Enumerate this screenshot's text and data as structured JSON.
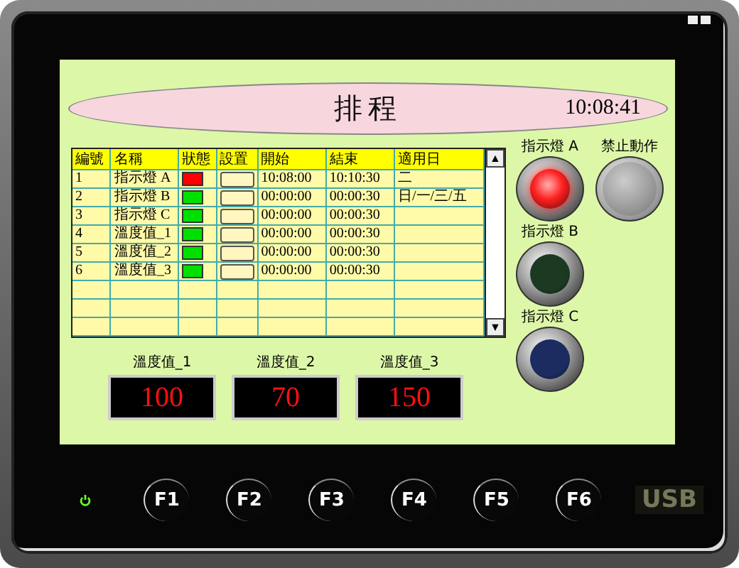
{
  "screen": {
    "title": "排程",
    "clock": "10:08:41",
    "table": {
      "columns": [
        "編號",
        "名稱",
        "狀態",
        "設置",
        "開始",
        "結束",
        "適用日"
      ],
      "rows": [
        {
          "number": "1",
          "name": "指示燈 A",
          "color": "#ff0000",
          "start": "10:08:00",
          "end": "10:10:30",
          "days": "二"
        },
        {
          "number": "2",
          "name": "指示燈 B",
          "color": "#00e000",
          "start": "00:00:00",
          "end": "00:00:30",
          "days": "日/一/三/五"
        },
        {
          "number": "3",
          "name": "指示燈 C",
          "color": "#00e000",
          "start": "00:00:00",
          "end": "00:00:30"
        },
        {
          "number": "4",
          "name": "溫度值_1",
          "color": "#00e000",
          "start": "00:00:00",
          "end": "00:00:30"
        },
        {
          "number": "5",
          "name": "溫度值_2",
          "color": "#00e000",
          "start": "00:00:00",
          "end": "00:00:30"
        },
        {
          "number": "6",
          "name": "溫度值_3",
          "color": "#00e000",
          "start": "00:00:00",
          "end": "00:00:30"
        }
      ],
      "scroll_up": "▲",
      "scroll_down": "▼"
    },
    "temperatures": [
      {
        "label": "溫度值_1",
        "value": "100"
      },
      {
        "label": "溫度值_2",
        "value": "70"
      },
      {
        "label": "溫度值_3",
        "value": "150"
      }
    ],
    "lights": [
      {
        "label": "指示燈 A",
        "color": "#ff2020",
        "on": true
      },
      {
        "label": "指示燈 B",
        "color": "#1c3a22",
        "on": false
      },
      {
        "label": "指示燈 C",
        "color": "#1c2c60",
        "on": false
      }
    ],
    "disable_button": {
      "label": "禁止動作"
    }
  },
  "keys": [
    "F1",
    "F2",
    "F3",
    "F4",
    "F5",
    "F6"
  ],
  "usb": "USB",
  "power_led": {
    "on": true
  }
}
